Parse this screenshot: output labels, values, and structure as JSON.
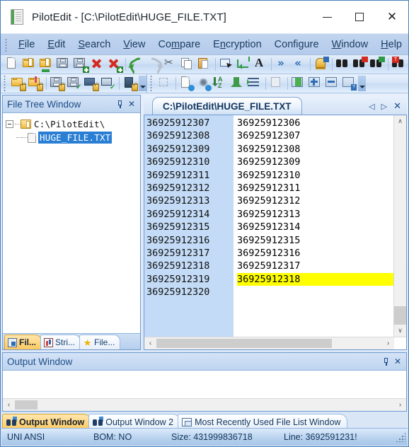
{
  "window": {
    "title": "PilotEdit - [C:\\PilotEdit\\HUGE_FILE.TXT]",
    "app_icon": "document-icon",
    "minimize": "─",
    "maximize": "□",
    "close": "✕"
  },
  "menu": [
    {
      "pre": "",
      "key": "F",
      "post": "ile"
    },
    {
      "pre": "",
      "key": "E",
      "post": "dit"
    },
    {
      "pre": "",
      "key": "S",
      "post": "earch"
    },
    {
      "pre": "",
      "key": "V",
      "post": "iew"
    },
    {
      "pre": "Co",
      "key": "m",
      "post": "pare"
    },
    {
      "pre": "E",
      "key": "n",
      "post": "cryption"
    },
    {
      "pre": "Confi",
      "key": "g",
      "post": "ure"
    },
    {
      "pre": "",
      "key": "W",
      "post": "indow"
    },
    {
      "pre": "",
      "key": "H",
      "post": "elp"
    }
  ],
  "toolbar_row1": [
    "new-file-icon",
    "open-file-icon",
    "open-ftp-file-icon",
    "save-icon",
    "save-as-icon",
    "close-file-icon",
    "close-all-files-icon",
    "sep",
    "undo-icon",
    "redo-icon",
    "cut-icon",
    "copy-icon",
    "paste-icon",
    "sep",
    "select-mode-icon",
    "word-wrap-icon",
    "font-icon",
    "sep",
    "next-bookmark-icon",
    "previous-bookmark-icon",
    "sep",
    "toggle-bookmark-icon",
    "sep",
    "find-icon",
    "find-previous-icon",
    "find-next-icon",
    "sep",
    "find-replace-icon",
    "sep",
    "goto-line-icon"
  ],
  "toolbar_row2": [
    "open-encrypted-folder-icon",
    "save-encrypted-folder-icon",
    "sep",
    "open-encrypted-file-icon",
    "save-encrypted-file-icon",
    "ftp-encrypted-download-icon",
    "ftp-encrypted-upload-icon",
    "sep",
    "encryption-key-icon"
  ],
  "toolbar_row3": [
    "compare-directories-icon",
    "sep",
    "file-settings-icon",
    "global-settings-icon",
    "sort-az-icon",
    "move-up-icon",
    "indent-icon",
    "sep",
    "preview-icon",
    "sep",
    "expand-collapse-icon",
    "expand-all-icon",
    "collapse-all-icon",
    "help-settings-icon"
  ],
  "file_tree": {
    "caption": "File Tree Window",
    "pin_icon": "pin-icon",
    "close_icon": "close-icon",
    "nodes": [
      {
        "label": "C:\\PilotEdit\\",
        "type": "folder",
        "selected": false
      },
      {
        "label": "HUGE_FILE.TXT",
        "type": "file",
        "selected": true
      }
    ],
    "tabs": [
      {
        "label": "Fil...",
        "icon": "file-tree-icon",
        "active": true
      },
      {
        "label": "Stri...",
        "icon": "string-list-icon",
        "active": false
      },
      {
        "label": "File...",
        "icon": "favorites-icon",
        "active": false
      }
    ]
  },
  "editor": {
    "tab_label": "C:\\PilotEdit\\HUGE_FILE.TXT",
    "tab_prev_icon": "◁",
    "tab_next_icon": "▷",
    "tab_close_icon": "✕",
    "line_numbers": [
      "36925912307",
      "36925912308",
      "36925912309",
      "36925912310",
      "36925912311",
      "36925912312",
      "36925912313",
      "36925912314",
      "36925912315",
      "36925912316",
      "36925912317",
      "36925912318",
      "36925912319",
      "36925912320"
    ],
    "lines": [
      {
        "text": "36925912306",
        "highlighted": false
      },
      {
        "text": "36925912307",
        "highlighted": false
      },
      {
        "text": "36925912308",
        "highlighted": false
      },
      {
        "text": "36925912309",
        "highlighted": false
      },
      {
        "text": "36925912310",
        "highlighted": false
      },
      {
        "text": "36925912311",
        "highlighted": false
      },
      {
        "text": "36925912312",
        "highlighted": false
      },
      {
        "text": "36925912313",
        "highlighted": false
      },
      {
        "text": "36925912314",
        "highlighted": false
      },
      {
        "text": "36925912315",
        "highlighted": false
      },
      {
        "text": "36925912316",
        "highlighted": false
      },
      {
        "text": "36925912317",
        "highlighted": false
      },
      {
        "text": "36925912318",
        "highlighted": true
      }
    ],
    "scroll_up_icon": "∧",
    "scroll_down_icon": "∨",
    "scroll_left_icon": "‹",
    "scroll_right_icon": "›"
  },
  "output": {
    "caption": "Output Window",
    "pin_icon": "pin-icon",
    "close_icon": "close-icon",
    "content": "",
    "scroll_left_icon": "‹",
    "scroll_right_icon": "›",
    "tabs": [
      {
        "label": "Output Window",
        "icon": "binoculars-icon",
        "active": true
      },
      {
        "label": "Output Window 2",
        "icon": "binoculars-icon",
        "active": false
      },
      {
        "label": "Most Recently Used File List Window",
        "icon": "window-list-icon",
        "active": false
      }
    ]
  },
  "statusbar": {
    "encoding_label": "UNI:",
    "encoding": "ANSI",
    "bom": "BOM: NO",
    "size": "Size: 431999836718",
    "line": "Line: 3692591231!"
  },
  "colors": {
    "accent": "#2a7fd4",
    "gutter_bg": "#c3dbf6",
    "highlight": "#ffff00",
    "tab_active": "#fbc85c",
    "window_border": "#4a7ebb"
  }
}
